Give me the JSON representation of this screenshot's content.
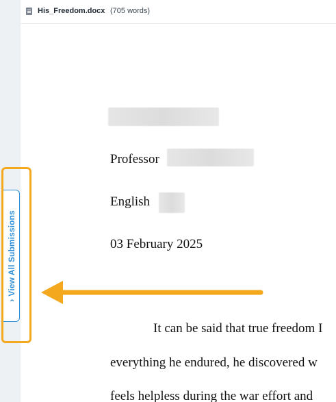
{
  "header": {
    "filename": "His_Freedom.docx",
    "word_count": "(705 words)"
  },
  "sidebar": {
    "view_all_label": "View All Submissions"
  },
  "document": {
    "professor_label": "Professor",
    "course_label": "English",
    "date": "03 February 2025",
    "body_lines": [
      "It can be said that true freedom I",
      "everything he endured, he discovered w",
      "feels helpless during the war effort and"
    ]
  },
  "colors": {
    "accent_blue": "#2f8fd8",
    "annotation_orange": "#f4a81e"
  },
  "icons": {
    "document": "document-icon",
    "chevron": "chevron-down-icon"
  }
}
